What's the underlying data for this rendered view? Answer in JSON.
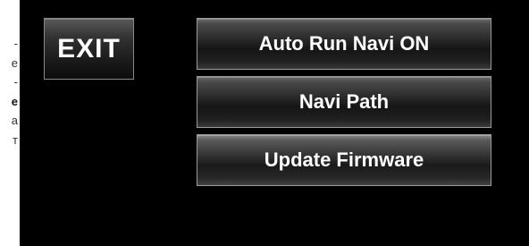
{
  "side_text": {
    "lines": [
      "-",
      "e",
      "-",
      "e",
      "a",
      "т"
    ]
  },
  "buttons": {
    "exit_label": "EXIT",
    "auto_run_label": "Auto Run Navi ON",
    "navi_path_label": "Navi Path",
    "update_firmware_label": "Update Firmware"
  },
  "colors": {
    "screen_background": "#000000",
    "button_text": "#ffffff",
    "button_border": "#9a9a9a"
  }
}
